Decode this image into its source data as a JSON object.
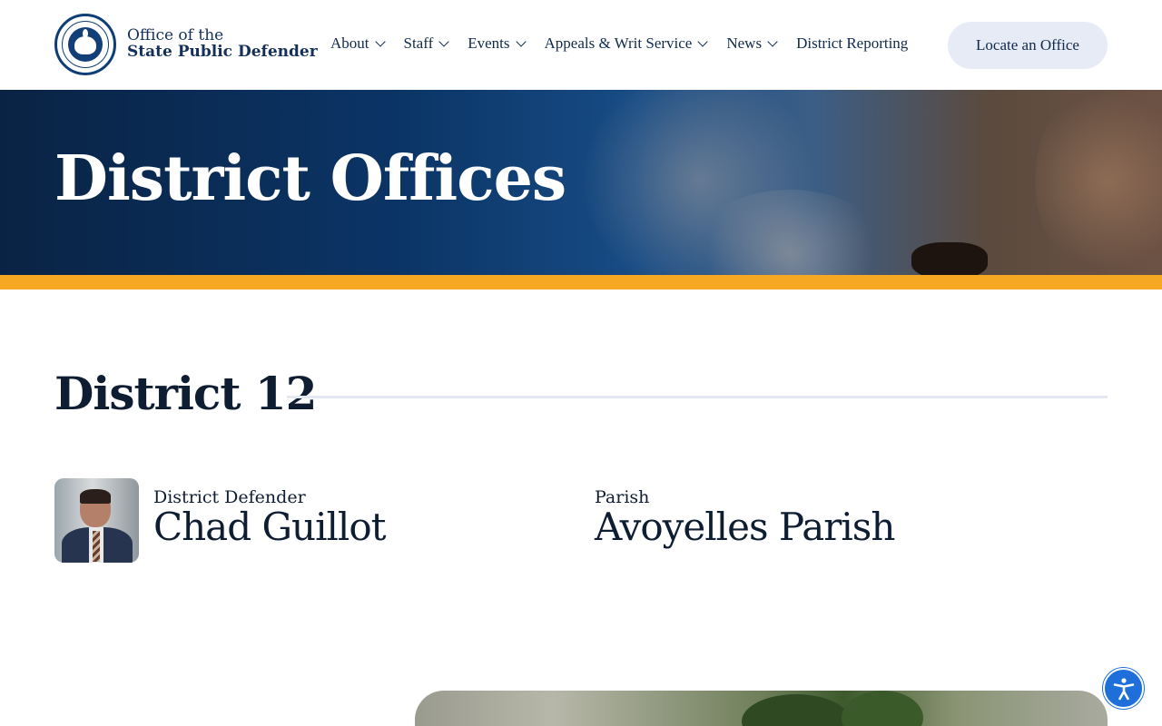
{
  "header": {
    "logo": {
      "line1": "Office of the",
      "line2": "State Public Defender",
      "seal_icon": "louisiana-state-seal-icon"
    },
    "nav": [
      {
        "label": "About",
        "has_dropdown": true
      },
      {
        "label": "Staff",
        "has_dropdown": true
      },
      {
        "label": "Events",
        "has_dropdown": true
      },
      {
        "label": "Appeals & Writ Service",
        "has_dropdown": true
      },
      {
        "label": "News",
        "has_dropdown": true
      },
      {
        "label": "District Reporting",
        "has_dropdown": false
      }
    ],
    "cta_label": "Locate an Office"
  },
  "hero": {
    "title": "District Offices",
    "stripe_color": "#f7a823",
    "background_color": "#0b3567"
  },
  "district": {
    "title": "District 12",
    "defender": {
      "label": "District Defender",
      "name": "Chad Guillot"
    },
    "parish": {
      "label": "Parish",
      "name": "Avoyelles Parish"
    }
  },
  "accessibility": {
    "icon": "accessibility-icon",
    "color": "#1e6fd9"
  }
}
